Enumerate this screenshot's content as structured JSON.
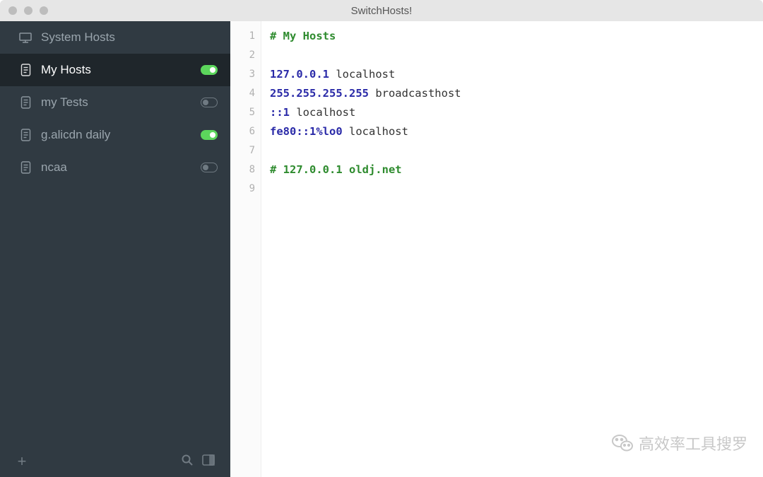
{
  "window": {
    "title": "SwitchHosts!"
  },
  "sidebar": {
    "system_label": "System Hosts",
    "items": [
      {
        "label": "My Hosts",
        "on": true,
        "selected": true
      },
      {
        "label": "my Tests",
        "on": false,
        "selected": false
      },
      {
        "label": "g.alicdn daily",
        "on": true,
        "selected": false
      },
      {
        "label": "ncaa",
        "on": false,
        "selected": false
      }
    ]
  },
  "editor": {
    "lines": [
      [
        {
          "t": "comment",
          "s": "# My Hosts"
        }
      ],
      [],
      [
        {
          "t": "ip",
          "s": "127.0.0.1"
        },
        {
          "t": "host",
          "s": " localhost"
        }
      ],
      [
        {
          "t": "ip",
          "s": "255.255.255.255"
        },
        {
          "t": "host",
          "s": " broadcasthost"
        }
      ],
      [
        {
          "t": "ip",
          "s": "::1"
        },
        {
          "t": "host",
          "s": " localhost"
        }
      ],
      [
        {
          "t": "ip",
          "s": "fe80::1%lo0"
        },
        {
          "t": "host",
          "s": " localhost"
        }
      ],
      [],
      [
        {
          "t": "comment",
          "s": "# 127.0.0.1 oldj.net"
        }
      ],
      []
    ]
  },
  "watermark": {
    "text": "高效率工具搜罗"
  }
}
